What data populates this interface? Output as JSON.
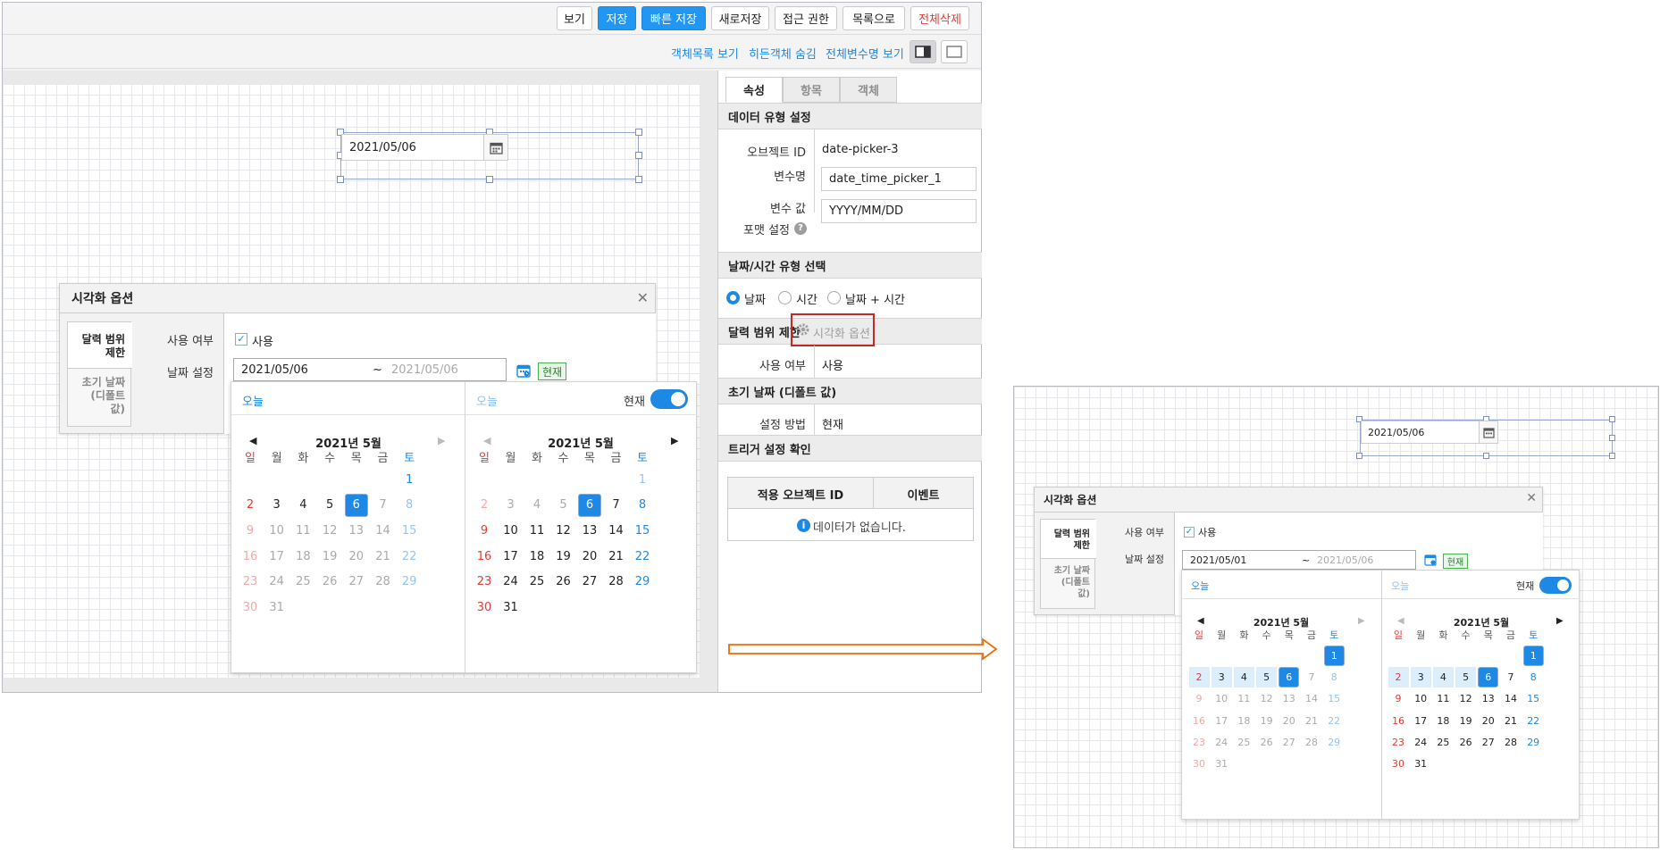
{
  "toolbar": {
    "buttons": [
      "보기",
      "저장",
      "빠른 저장",
      "새로저장",
      "접근 권한",
      "목록으로",
      "전체삭제"
    ]
  },
  "subbar": {
    "links": [
      "객체목록 보기",
      "히든객체 숨김",
      "전체변수명 보기"
    ]
  },
  "canvas": {
    "datepicker_value": "2021/05/06"
  },
  "right_panel": {
    "tabs": [
      "속성",
      "항목",
      "객체"
    ],
    "section_data_type": "데이터 유형 설정",
    "object_id_label": "오브젝트 ID",
    "object_id_value": "date-picker-3",
    "varname_label": "변수명",
    "varname_value": "date_time_picker_1",
    "varvalue_label": "변수 값",
    "format_label": "포맷 설정",
    "format_value": "YYYY/MM/DD",
    "section_type_select": "날짜/시간 유형 선택",
    "radio_options": [
      "날짜",
      "시간",
      "날짜 + 시간"
    ],
    "section_range": "달력 범위 제한",
    "viz_option_link": "시각화 옵션",
    "use_label": "사용 여부",
    "use_value": "사용",
    "section_initial": "초기 날짜 (디폴트 값)",
    "method_label": "설정 방법",
    "method_value": "현재",
    "section_trigger": "트리거 설정 확인",
    "trigger_headers": [
      "적용 오브젝트 ID",
      "이벤트"
    ],
    "trigger_empty": "데이터가 없습니다."
  },
  "popup_left": {
    "title": "시각화 옵션",
    "side_items": [
      "달력 범위\n제한",
      "초기 날짜\n(디폴트\n값)"
    ],
    "use_label": "사용 여부",
    "use_check": "사용",
    "date_label": "날짜 설정",
    "start_date": "2021/05/06",
    "tilde": "~",
    "end_date": "2021/05/06",
    "now_badge": "현재",
    "today_left": "오늘",
    "today_right": "오늘",
    "toggle_label": "현재",
    "month_left": "2021년 5월",
    "month_right": "2021년 5월"
  },
  "popup_right": {
    "title": "시각화 옵션",
    "side_items": [
      "달력 범위\n제한",
      "초기 날짜\n(디폴트\n값)"
    ],
    "use_label": "사용 여부",
    "use_check": "사용",
    "date_label": "날짜 설정",
    "start_date": "2021/05/01",
    "tilde": "~",
    "end_date": "2021/05/06",
    "now_badge": "현재",
    "today_left": "오늘",
    "today_right": "오늘",
    "toggle_label": "현재",
    "month_left": "2021년 5월",
    "month_right": "2021년 5월",
    "datepicker_value": "2021/05/06"
  },
  "weekdays": [
    "일",
    "월",
    "화",
    "수",
    "목",
    "금",
    "토"
  ],
  "days": [
    "1",
    "2",
    "3",
    "4",
    "5",
    "6",
    "7",
    "8",
    "9",
    "10",
    "11",
    "12",
    "13",
    "14",
    "15",
    "16",
    "17",
    "18",
    "19",
    "20",
    "21",
    "22",
    "23",
    "24",
    "25",
    "26",
    "27",
    "28",
    "29",
    "30",
    "31"
  ],
  "calendar_state": {
    "selected_day": 6,
    "first_weekday": 6,
    "range_start": 1,
    "range_end": 6
  },
  "colors": {
    "accent": "#1e88e5",
    "danger": "#e53935",
    "highlight_box": "#c62828",
    "arrow": "#ef6c00"
  }
}
